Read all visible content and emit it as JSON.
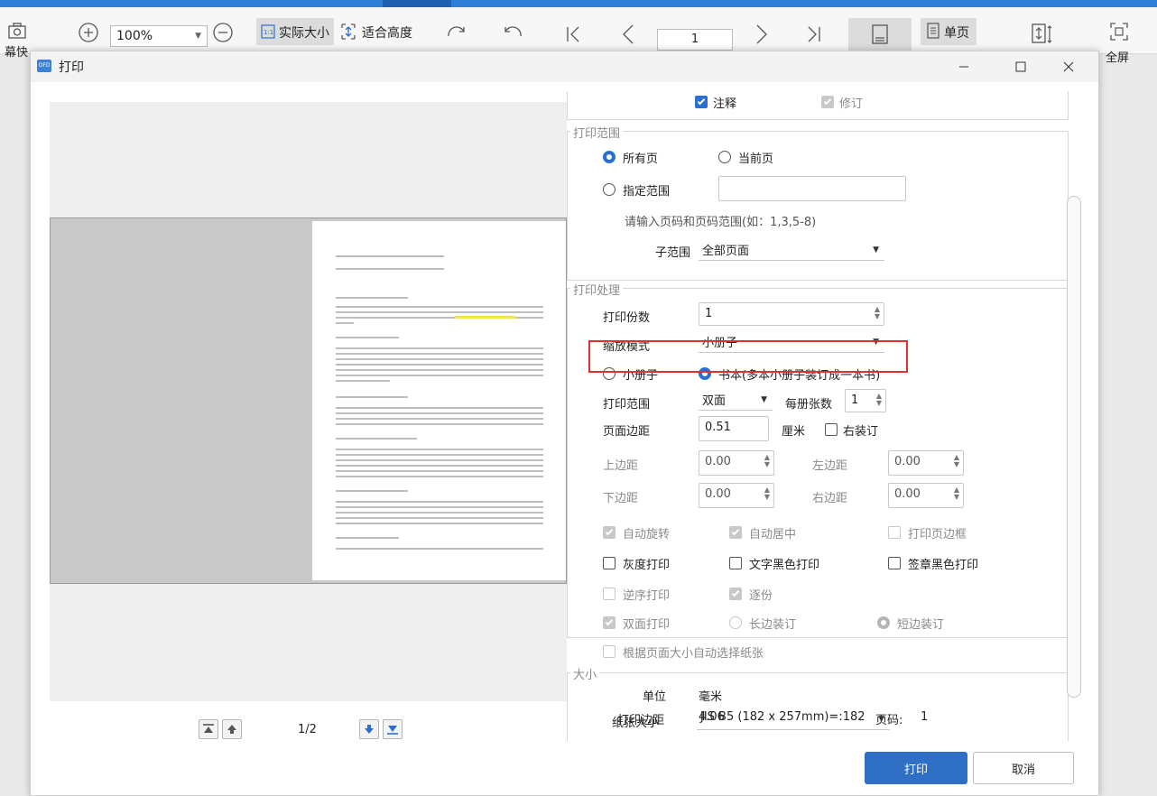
{
  "toolbar": {
    "left_label": "幕快",
    "zoom_value": "100%",
    "actual_size": "实际大小",
    "fit_height": "适合高度",
    "page_number": "1",
    "single_page": "单页",
    "fullscreen": "全屏",
    "fit_height_below": "页"
  },
  "dialog": {
    "title": "打印",
    "icon_text": "OFD"
  },
  "preview": {
    "page_indicator": "1/2"
  },
  "settings": {
    "annotation": "注释",
    "revision": "修订",
    "range_group": "打印范围",
    "all_pages": "所有页",
    "current_page": "当前页",
    "specify_range": "指定范围",
    "range_hint": "请输入页码和页码范围(如：1,3,5-8)",
    "subrange_label": "子范围",
    "subrange_value": "全部页面",
    "process_group": "打印处理",
    "copies_label": "打印份数",
    "copies_value": "1",
    "scale_label": "缩放模式",
    "scale_value": "小册子",
    "booklet": "小册子",
    "book": "书本(多本小册子装订成一本书)",
    "print_range_label": "打印范围",
    "print_range_value": "双面",
    "per_book_label": "每册张数",
    "per_book_value": "1",
    "margin_label": "页面边距",
    "margin_value": "0.51",
    "margin_unit": "厘米",
    "right_binding": "右装订",
    "top_margin_label": "上边距",
    "top_margin_value": "0.00",
    "left_margin_label": "左边距",
    "left_margin_value": "0.00",
    "bottom_margin_label": "下边距",
    "bottom_margin_value": "0.00",
    "right_margin_label": "右边距",
    "right_margin_value": "0.00",
    "auto_rotate": "自动旋转",
    "auto_center": "自动居中",
    "print_border": "打印页边框",
    "grayscale": "灰度打印",
    "text_black": "文字黑色打印",
    "stamp_black": "签章黑色打印",
    "reverse": "逆序打印",
    "collate": "逐份",
    "duplex": "双面打印",
    "long_edge": "长边装订",
    "short_edge": "短边装订",
    "auto_paper": "根据页面大小自动选择纸张",
    "size_group": "大小",
    "unit_label": "单位",
    "unit_value": "毫米",
    "print_margin_label": "打印边距",
    "print_margin_value": "4.06",
    "page_code_label": "页码:",
    "page_code_value": "1",
    "paper_size_label": "纸张大小",
    "paper_size_value": "JIS B5 (182 x 257mm)=:182"
  },
  "buttons": {
    "print": "打印",
    "cancel": "取消"
  },
  "colors": {
    "accent": "#2a6fd1",
    "highlight_box": "#e03030"
  }
}
